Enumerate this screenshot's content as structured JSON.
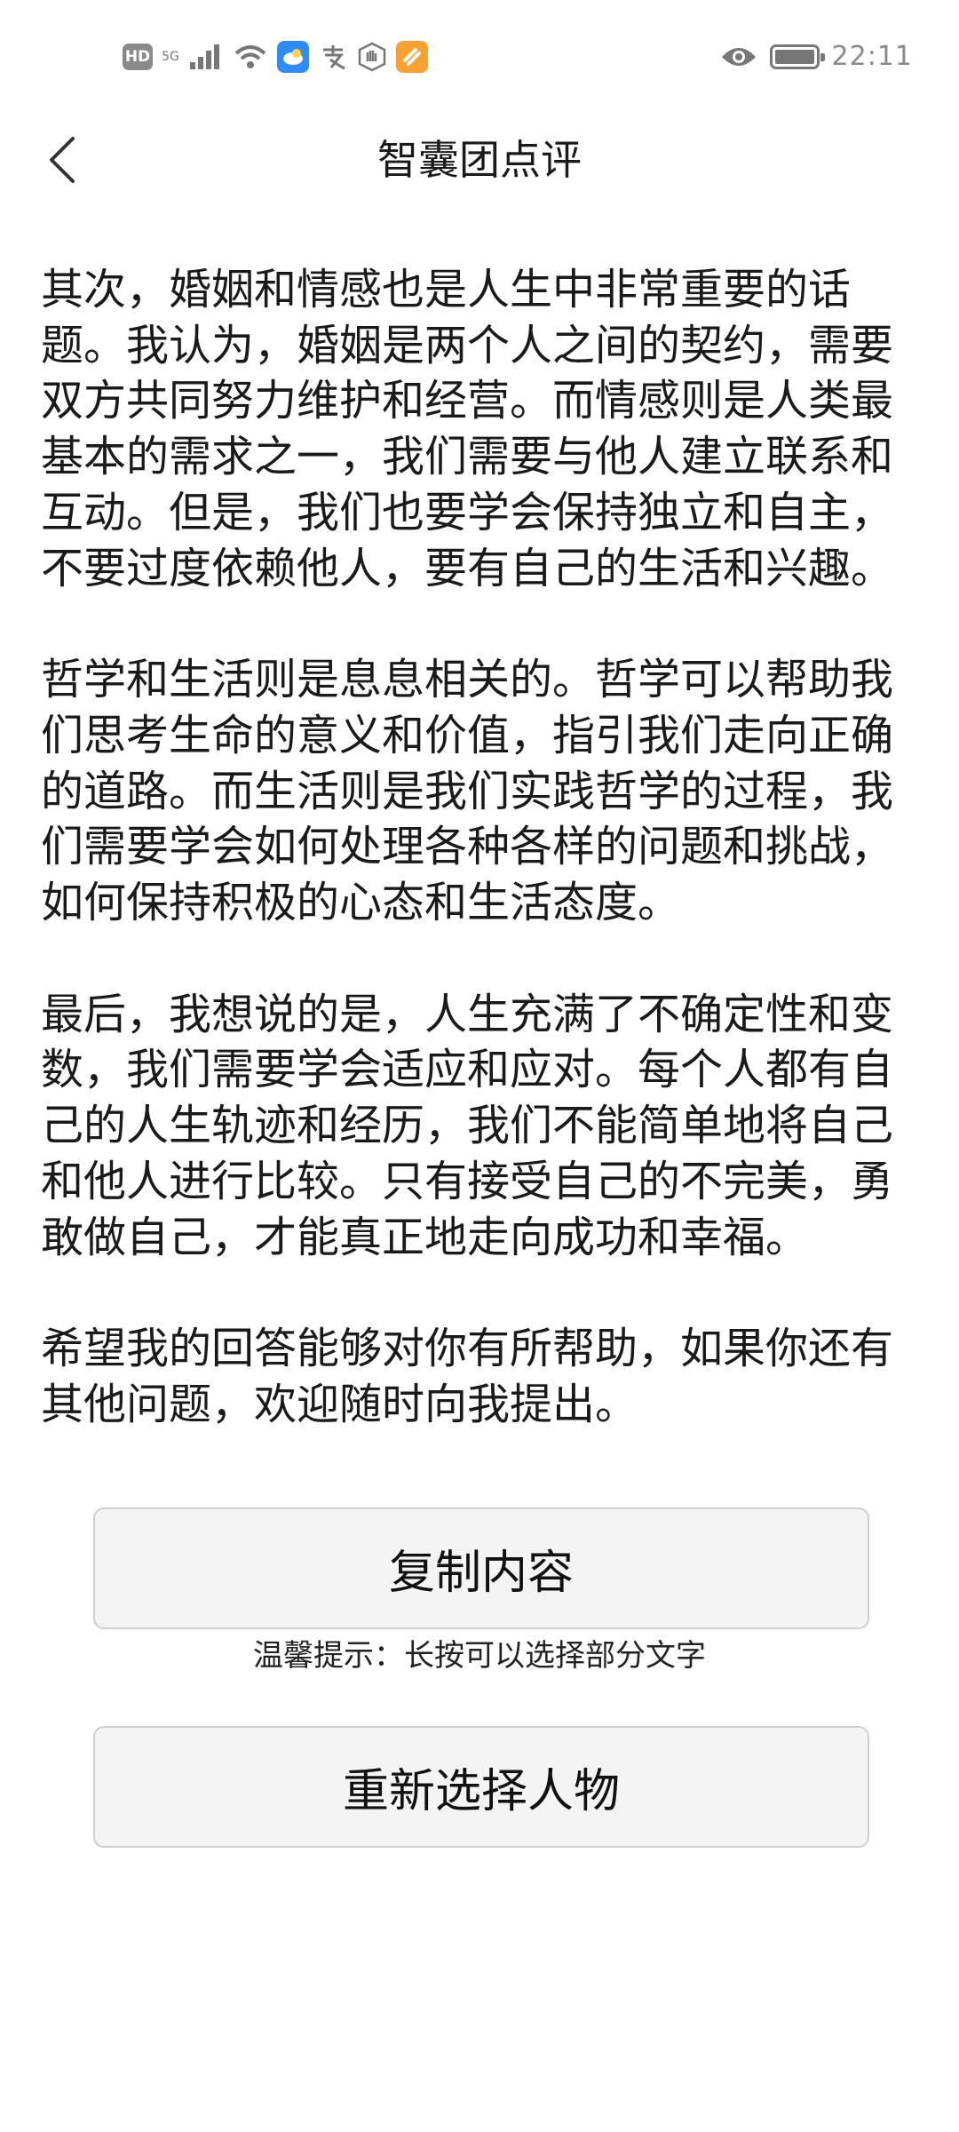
{
  "status_bar": {
    "hd": "HD",
    "network": "5G",
    "time": "22:11",
    "icons": [
      "signal-icon",
      "wifi-icon",
      "weather-app-icon",
      "alipay-icon",
      "hand-icon",
      "app-orange-icon",
      "eye-icon",
      "battery-icon"
    ]
  },
  "header": {
    "title": "智囊团点评"
  },
  "content": {
    "paragraphs": [
      "其次，婚姻和情感也是人生中非常重要的话题。我认为，婚姻是两个人之间的契约，需要双方共同努力维护和经营。而情感则是人类最基本的需求之一，我们需要与他人建立联系和互动。但是，我们也要学会保持独立和自主，不要过度依赖他人，要有自己的生活和兴趣。",
      "哲学和生活则是息息相关的。哲学可以帮助我们思考生命的意义和价值，指引我们走向正确的道路。而生活则是我们实践哲学的过程，我们需要学会如何处理各种各样的问题和挑战，如何保持积极的心态和生活态度。",
      "最后，我想说的是，人生充满了不确定性和变数，我们需要学会适应和应对。每个人都有自己的人生轨迹和经历，我们不能简单地将自己和他人进行比较。只有接受自己的不完美，勇敢做自己，才能真正地走向成功和幸福。",
      "希望我的回答能够对你有所帮助，如果你还有其他问题，欢迎随时向我提出。"
    ]
  },
  "actions": {
    "copy_label": "复制内容",
    "hint": "温馨提示：长按可以选择部分文字",
    "reselect_label": "重新选择人物"
  }
}
